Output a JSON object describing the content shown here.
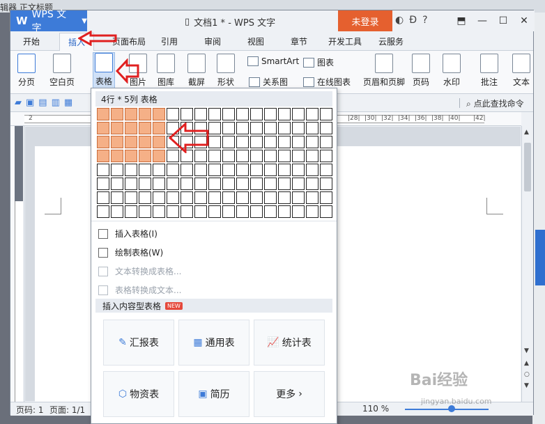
{
  "background": {
    "left_text": "辑器 正文标题"
  },
  "titlebar": {
    "app_name": "WPS 文字",
    "document_title": "文档1 * - WPS 文字",
    "login_label": "未登录"
  },
  "tabs": [
    "开始",
    "插入",
    "页面布局",
    "引用",
    "审阅",
    "视图",
    "章节",
    "开发工具",
    "云服务"
  ],
  "active_tab": "插入",
  "ribbon": {
    "page_break": "分页",
    "blank_page": "空白页",
    "table": "表格",
    "picture": "图片",
    "gallery": "图库",
    "screenshot": "截屏",
    "shapes": "形状",
    "smartart": "SmartArt",
    "chart": "图表",
    "relation": "关系图",
    "online_chart": "在线图表",
    "header_footer": "页眉和页脚",
    "page_number": "页码",
    "watermark": "水印",
    "comment": "批注",
    "textbox": "文本"
  },
  "quickbar": {
    "search_command": "点此查找命令"
  },
  "ruler": {
    "left_label": "2",
    "right_labels": [
      "|28|",
      "|30|",
      "|32|",
      "|34|",
      "|36|",
      "|38|",
      "|40|",
      "|42|"
    ]
  },
  "table_dropdown": {
    "header": "4行 * 5列 表格",
    "grid_cols": 17,
    "grid_rows": 8,
    "selected_rows": 4,
    "selected_cols": 5,
    "items": [
      {
        "label": "插入表格(I)",
        "enabled": true
      },
      {
        "label": "绘制表格(W)",
        "enabled": true
      },
      {
        "label": "文本转换成表格...",
        "enabled": false
      },
      {
        "label": "表格转换成文本...",
        "enabled": false
      }
    ],
    "section_title": "插入内容型表格",
    "section_badge": "NEW",
    "cards": [
      "汇报表",
      "通用表",
      "统计表",
      "物资表",
      "简历",
      "更多"
    ]
  },
  "statusbar": {
    "page": "页码: 1",
    "pages": "页面: 1/1",
    "zoom": "110 %"
  },
  "watermark": {
    "brand": "Bai经验",
    "url": "jingyan.baidu.com"
  },
  "colors": {
    "accent": "#3d7bd8",
    "login": "#e5602f",
    "highlight_cell": "#f5b087",
    "arrow": "#e02020"
  }
}
